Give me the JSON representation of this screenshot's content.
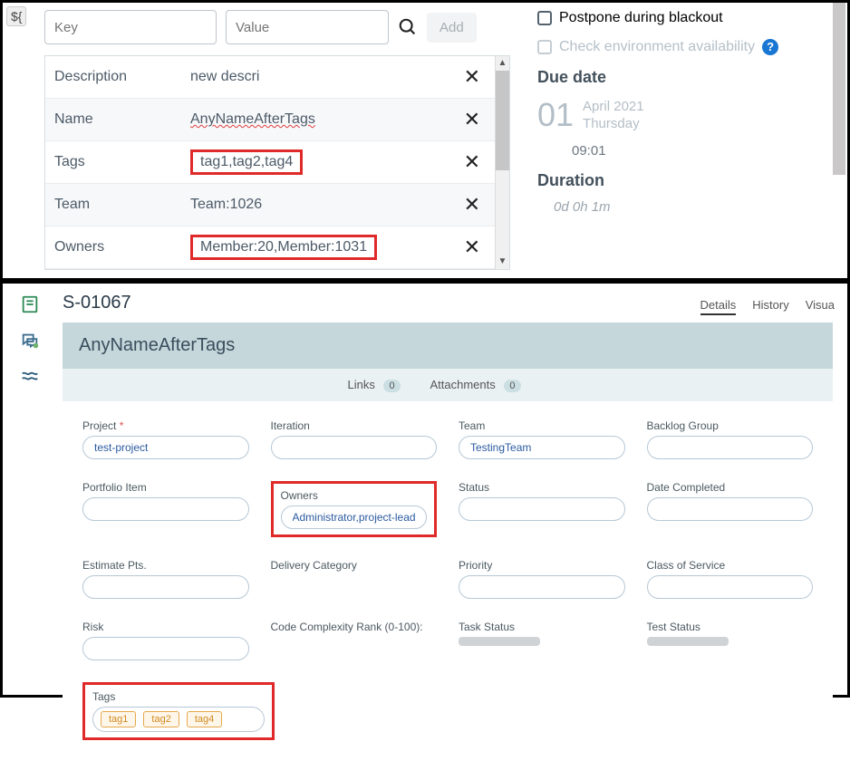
{
  "top": {
    "var_badge": "${",
    "key_placeholder": "Key",
    "value_placeholder": "Value",
    "add_label": "Add",
    "rows": [
      {
        "key": "Description",
        "value": "new descri"
      },
      {
        "key": "Name",
        "value": "AnyNameAfterTags"
      },
      {
        "key": "Tags",
        "value": "tag1,tag2,tag4"
      },
      {
        "key": "Team",
        "value": "Team:1026"
      },
      {
        "key": "Owners",
        "value": "Member:20,Member:1031"
      }
    ],
    "right": {
      "postpone_label": "Postpone during blackout",
      "check_env_label": "Check environment availability",
      "due_date_heading": "Due date",
      "day": "01",
      "month_year": "April 2021",
      "weekday": "Thursday",
      "time": "09:01",
      "duration_heading": "Duration",
      "duration_value": "0d 0h 1m"
    }
  },
  "bottom": {
    "story_id": "S-01067",
    "tabs": {
      "details": "Details",
      "history": "History",
      "visua": "Visua"
    },
    "title": "AnyNameAfterTags",
    "links_label": "Links",
    "links_count": "0",
    "attach_label": "Attachments",
    "attach_count": "0",
    "fields": {
      "project_label": "Project",
      "project_value": "test-project",
      "iteration_label": "Iteration",
      "team_label": "Team",
      "team_value": "TestingTeam",
      "backlog_label": "Backlog Group",
      "portfolio_label": "Portfolio Item",
      "owners_label": "Owners",
      "owners_value": "Administrator,project-lead",
      "status_label": "Status",
      "date_completed_label": "Date Completed",
      "estimate_label": "Estimate Pts.",
      "delivery_label": "Delivery Category",
      "priority_label": "Priority",
      "class_label": "Class of Service",
      "risk_label": "Risk",
      "complexity_label": "Code Complexity Rank (0-100):",
      "task_status_label": "Task Status",
      "test_status_label": "Test Status",
      "tags_label": "Tags",
      "tags": [
        "tag1",
        "tag2",
        "tag4"
      ]
    }
  }
}
